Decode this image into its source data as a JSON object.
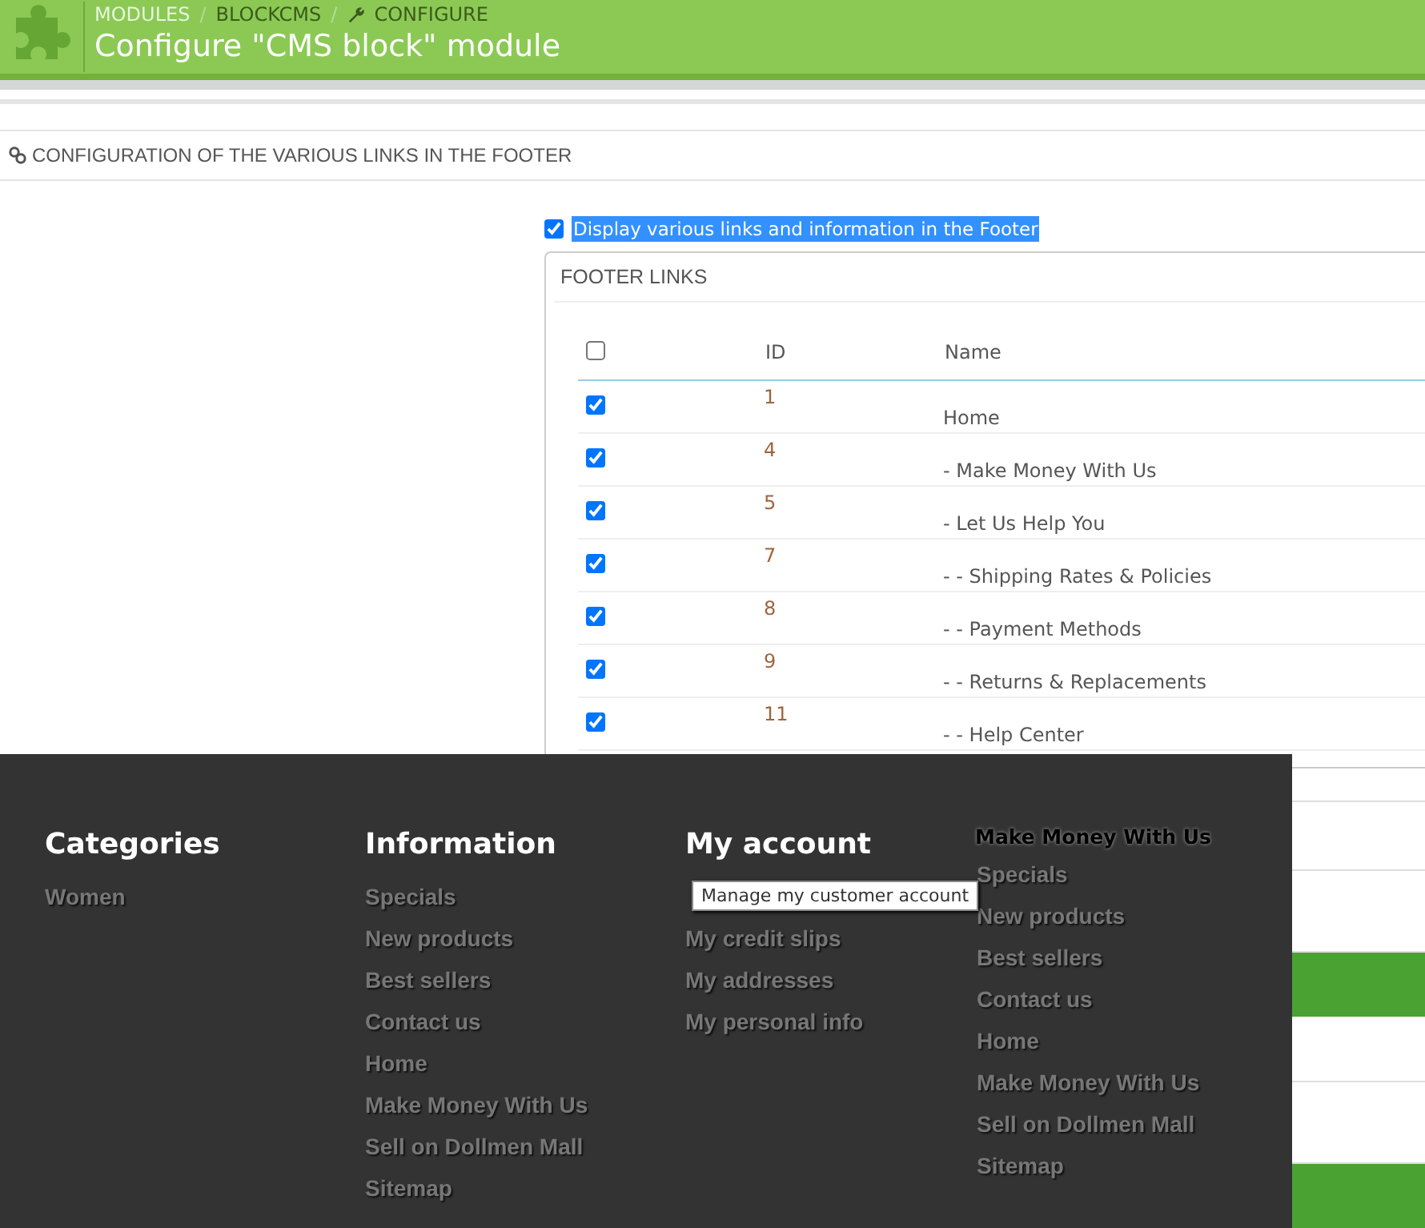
{
  "header": {
    "breadcrumbs": [
      "MODULES",
      "BLOCKCMS",
      "CONFIGURE"
    ],
    "separator": "/",
    "title": "Configure \"CMS block\" module"
  },
  "section": {
    "title": "CONFIGURATION OF THE VARIOUS LINKS IN THE FOOTER"
  },
  "display_option": {
    "label": "Display various links and information in the Footer",
    "checked": true,
    "highlighted": true
  },
  "footer_links": {
    "title": "FOOTER LINKS",
    "select_all": {
      "checked": false
    },
    "columns": [
      "ID",
      "Name"
    ],
    "rows": [
      {
        "checked": true,
        "id": "1",
        "name": "Home"
      },
      {
        "checked": true,
        "id": "4",
        "name": "- Make Money With Us"
      },
      {
        "checked": true,
        "id": "5",
        "name": "- Let Us Help You"
      },
      {
        "checked": true,
        "id": "7",
        "name": "- - Shipping Rates & Policies"
      },
      {
        "checked": true,
        "id": "8",
        "name": "- - Payment Methods"
      },
      {
        "checked": true,
        "id": "9",
        "name": "- - Returns & Replacements"
      },
      {
        "checked": true,
        "id": "11",
        "name": "- - Help Center"
      }
    ]
  },
  "footer_preview": {
    "columns": [
      {
        "title": "Categories",
        "kind": "large",
        "items": [
          "Women"
        ]
      },
      {
        "title": "Information",
        "kind": "large",
        "items": [
          "Specials",
          "New products",
          "Best sellers",
          "Contact us",
          "Home",
          "Make Money With Us",
          "Sell on Dollmen Mall",
          "Sitemap"
        ]
      },
      {
        "title": "My account",
        "kind": "large",
        "items": [
          "My credit slips",
          "My addresses",
          "My personal info"
        ],
        "tooltip": "Manage my customer account"
      },
      {
        "title": "Make Money With Us",
        "kind": "small",
        "items": [
          "Specials",
          "New products",
          "Best sellers",
          "Contact us",
          "Home",
          "Make Money With Us",
          "Sell on Dollmen Mall",
          "Sitemap"
        ]
      }
    ]
  }
}
